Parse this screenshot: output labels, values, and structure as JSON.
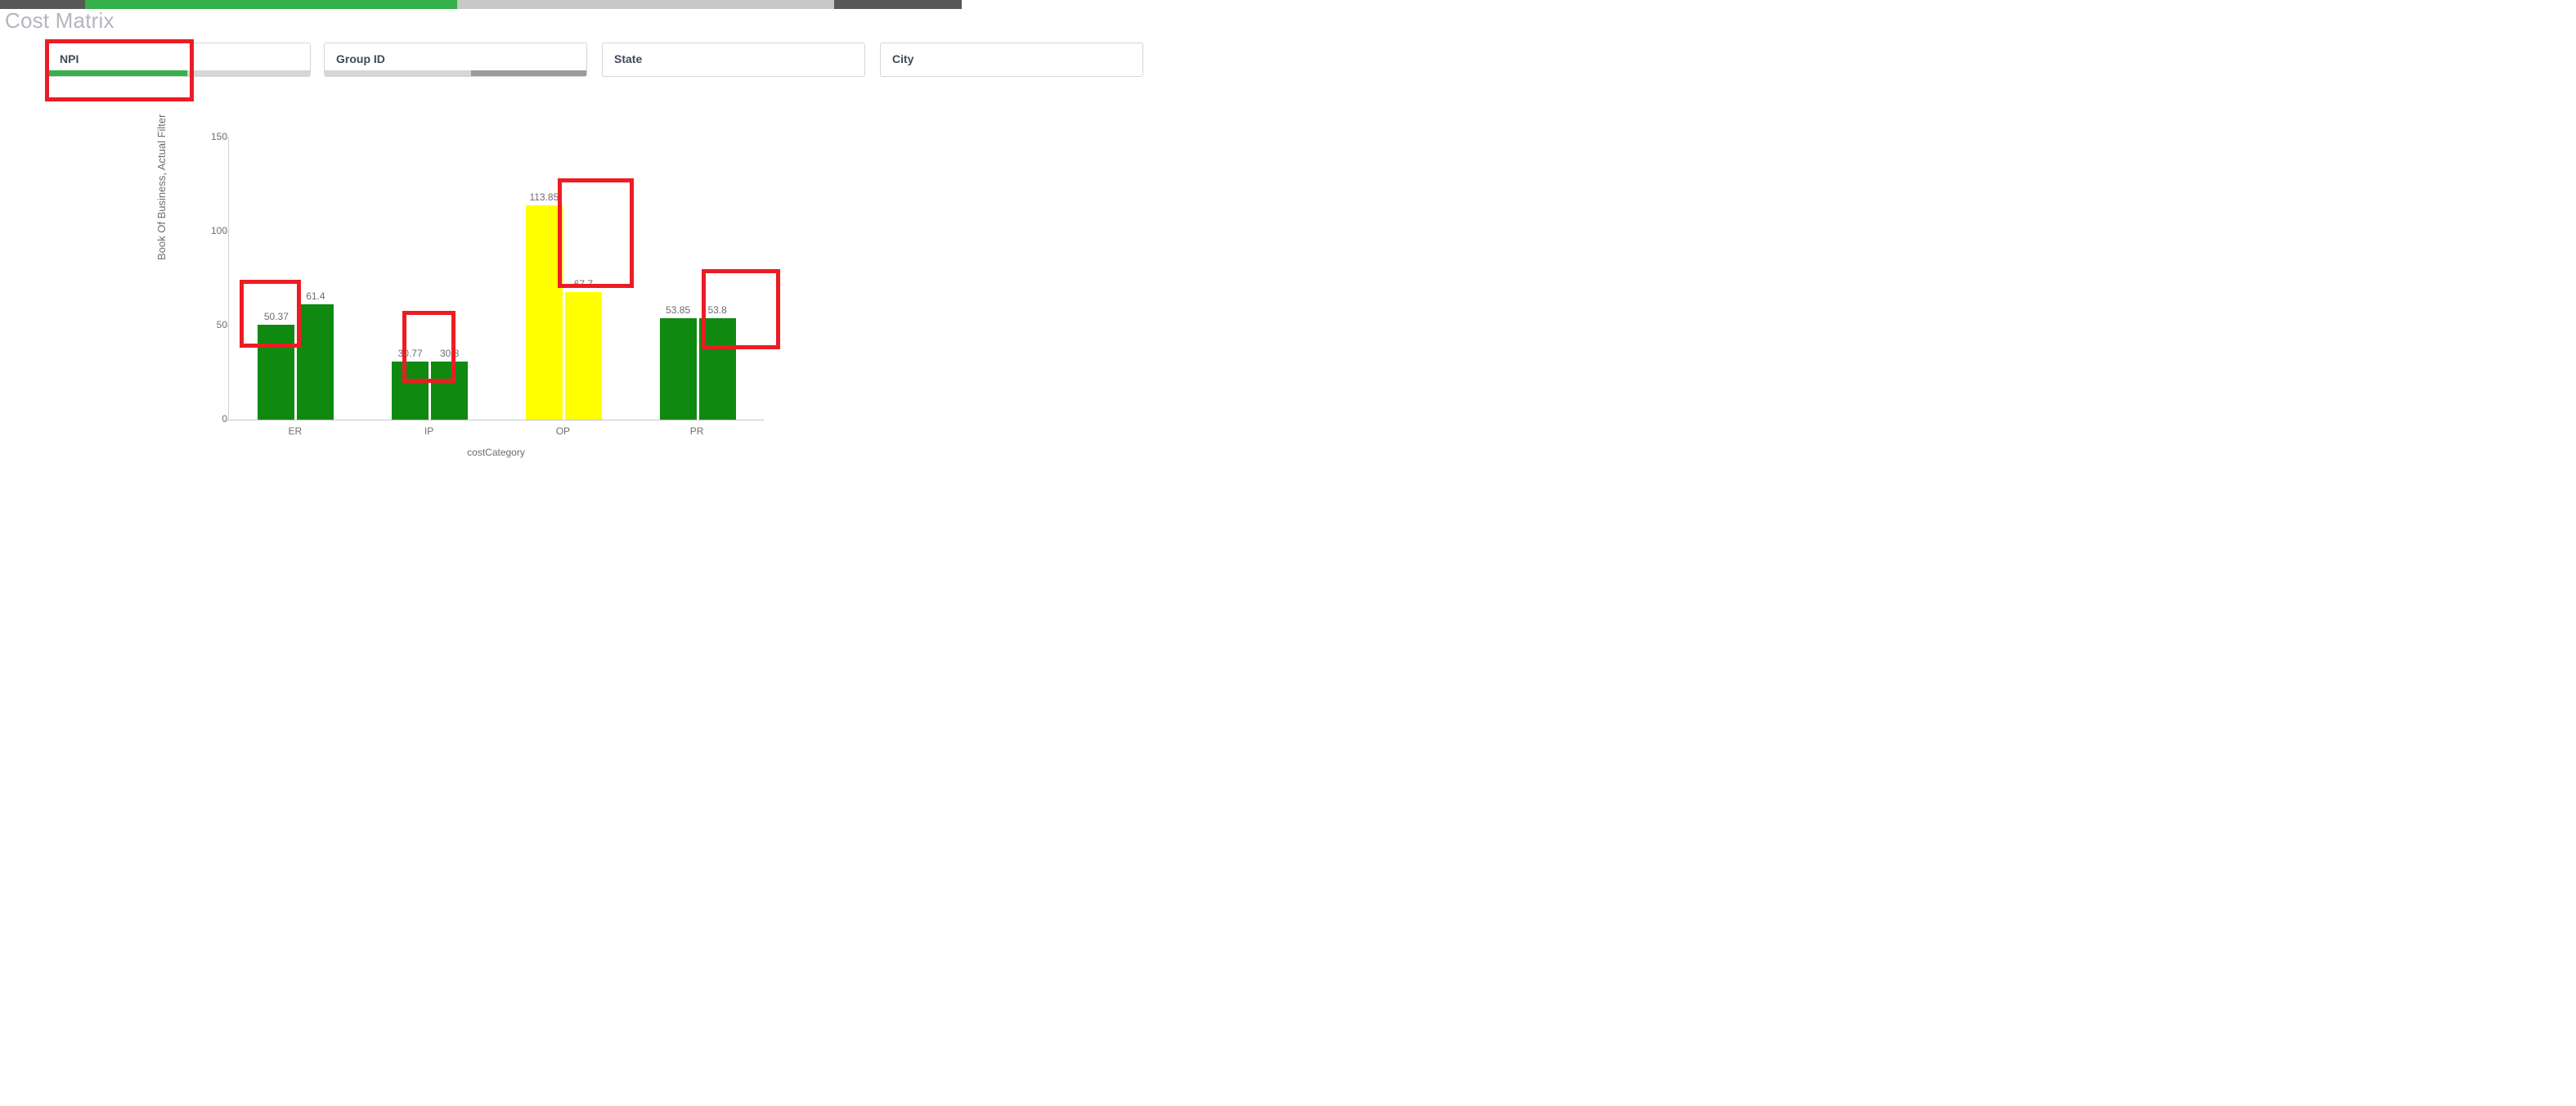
{
  "window": {
    "scrollbar": {
      "name": "horizontal-scrollbar",
      "fill_color": "#35b04a",
      "track_color": "#c8c8c8"
    }
  },
  "header": {
    "title": "Cost Matrix"
  },
  "filters": [
    {
      "id": "npi",
      "label": "NPI",
      "scroll": "green"
    },
    {
      "id": "groupid",
      "label": "Group ID",
      "scroll": "gray"
    },
    {
      "id": "state",
      "label": "State",
      "scroll": "none"
    },
    {
      "id": "city",
      "label": "City",
      "scroll": "none"
    }
  ],
  "annotations": {
    "color": "#ed1c24",
    "boxes": [
      {
        "name": "npi-filter-highlight",
        "target": "NPI filter"
      },
      {
        "name": "er-bar-highlight",
        "target": "ER first bar (50.37)"
      },
      {
        "name": "ip-bar-highlight",
        "target": "IP first bar (30.77)"
      },
      {
        "name": "op-bar-highlight",
        "target": "OP first bar (113.85)"
      },
      {
        "name": "pr-bar-highlight",
        "target": "PR first bar (53.85)"
      }
    ]
  },
  "chart_data": {
    "type": "bar",
    "title": "",
    "xlabel": "costCategory",
    "ylabel": "Book Of Business, Actual Filter",
    "categories": [
      "ER",
      "IP",
      "OP",
      "PR"
    ],
    "ylim": [
      0,
      150
    ],
    "yticks": [
      0,
      50,
      100,
      150
    ],
    "ytick_labels": [
      "0",
      "50",
      "100",
      "150"
    ],
    "grid": false,
    "legend": "none",
    "series": [
      {
        "name": "Book Of Business",
        "values": [
          50.37,
          30.77,
          113.85,
          53.85
        ],
        "labels": [
          "50.37",
          "30.77",
          "113.85",
          "53.85"
        ],
        "colors": [
          "#108910",
          "#108910",
          "#ffff00",
          "#108910"
        ]
      },
      {
        "name": "Actual Filter",
        "values": [
          61.4,
          30.8,
          67.7,
          53.8
        ],
        "labels": [
          "61.4",
          "30.8",
          "67.7",
          "53.8"
        ],
        "colors": [
          "#108910",
          "#108910",
          "#ffff00",
          "#108910"
        ]
      }
    ]
  }
}
